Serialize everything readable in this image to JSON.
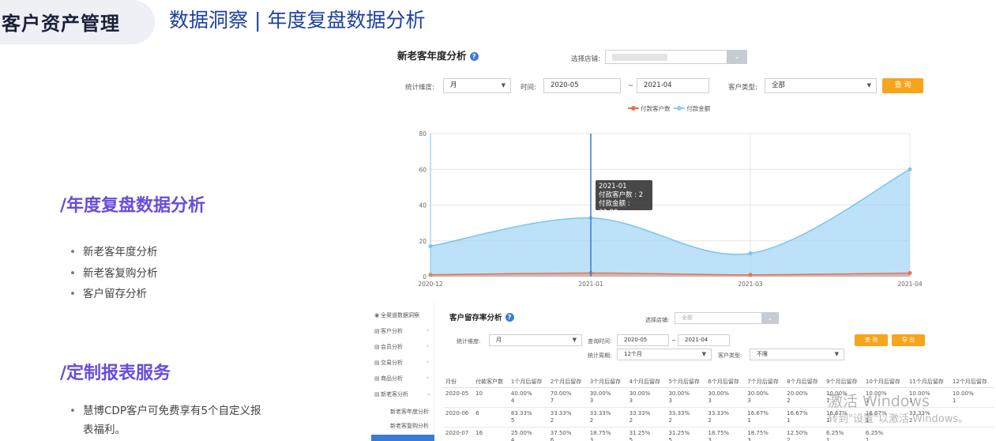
{
  "header": {
    "tab_title": "客户资产管理",
    "subtitle": "数据洞察 |  年度复盘数据分析"
  },
  "left": {
    "section1": {
      "title": "/年度复盘数据分析",
      "items": [
        "新老客年度分析",
        "新老客复购分析",
        "客户留存分析"
      ]
    },
    "section2": {
      "title": "/定制报表服务",
      "items": [
        "慧博CDP客户可免费享有5个自定义报表福利。"
      ]
    }
  },
  "panel1": {
    "title": "新老客年度分析",
    "help_icon": "?",
    "store_label": "选择店铺:",
    "dimension_label": "统计维度:",
    "dimension_value": "月",
    "time_label": "时间:",
    "time_from": "2020-05",
    "time_sep": "~",
    "time_to": "2021-04",
    "customer_type_label": "客户类型:",
    "customer_type_value": "全部",
    "query_label": "查 询",
    "legend": [
      "付款客户数",
      "付款金额"
    ]
  },
  "chart_data": {
    "type": "area",
    "x": [
      "2020-12",
      "2021-01",
      "2021-03",
      "2021-04"
    ],
    "ylim": [
      0,
      80
    ],
    "yticks": [
      0,
      20,
      40,
      60,
      80
    ],
    "grid": true,
    "legend_position": "top-center",
    "series": [
      {
        "name": "付款客户数",
        "values": [
          1,
          2,
          1,
          2
        ],
        "color": "#e8734a"
      },
      {
        "name": "付款金额",
        "values": [
          17,
          32.8,
          13,
          60
        ],
        "color": "#8fcdf4"
      }
    ],
    "tooltip": {
      "x": "2021-01",
      "lines": [
        "2021-01",
        "付款客户数 : 2",
        "付款金额 : 32.80"
      ]
    }
  },
  "panel2": {
    "title": "客户留存率分析",
    "help_icon": "?",
    "store_label": "选择店铺:",
    "store_value": "全部",
    "dimension_label": "统计维度:",
    "dimension_value": "月",
    "query_time_label": "查询时间:",
    "time_from": "2020-05",
    "time_sep": "~",
    "time_to": "2021-04",
    "period_label": "统计周期:",
    "period_value": "12个月",
    "customer_type_label": "客户类型:",
    "customer_type_value": "不限",
    "query_label": "查 询",
    "export_label": "导 出",
    "sidebar": [
      {
        "icon": "◉",
        "label": "全渠道数据洞察",
        "chev": ""
      },
      {
        "icon": "▤",
        "label": "客户分析",
        "chev": "‹"
      },
      {
        "icon": "▤",
        "label": "会员分析",
        "chev": "‹"
      },
      {
        "icon": "▤",
        "label": "交易分析",
        "chev": "‹"
      },
      {
        "icon": "▤",
        "label": "商品分析",
        "chev": "‹"
      },
      {
        "icon": "▤",
        "label": "新老客分析",
        "chev": "⌄"
      },
      {
        "icon": "",
        "label": "新老客年度分析",
        "chev": ""
      },
      {
        "icon": "",
        "label": "新老客复购分析",
        "chev": ""
      }
    ],
    "columns": [
      "月份",
      "付款客户数",
      "1个月后留存",
      "2个月后留存",
      "3个月后留存",
      "4个月后留存",
      "5个月后留存",
      "6个月后留存",
      "7个月后留存",
      "8个月后留存",
      "9个月后留存",
      "10个月后留存",
      "11个月后留存",
      "12个月后留存"
    ],
    "rows": [
      [
        "2020-05",
        "10",
        [
          "40.00%",
          "4"
        ],
        [
          "70.00%",
          "7"
        ],
        [
          "30.00%",
          "3"
        ],
        [
          "30.00%",
          "3"
        ],
        [
          "30.00%",
          "3"
        ],
        [
          "30.00%",
          "3"
        ],
        [
          "30.00%",
          "3"
        ],
        [
          "20.00%",
          "2"
        ],
        [
          "10.00%",
          "1"
        ],
        [
          "10.00%",
          "1"
        ],
        [
          "10.00%",
          "1"
        ],
        [
          "10.00%",
          "1"
        ]
      ],
      [
        "2020-06",
        "6",
        [
          "83.33%",
          "5"
        ],
        [
          "33.33%",
          "2"
        ],
        [
          "33.33%",
          "2"
        ],
        [
          "33.33%",
          "2"
        ],
        [
          "33.33%",
          "2"
        ],
        [
          "33.33%",
          "2"
        ],
        [
          "16.67%",
          "1"
        ],
        [
          "16.67%",
          "1"
        ],
        [
          "16.67%",
          "1"
        ],
        [
          "16.67%",
          "1"
        ],
        [
          "33.33%",
          "2"
        ],
        [
          "",
          ""
        ]
      ],
      [
        "2020-07",
        "16",
        [
          "25.00%",
          "4"
        ],
        [
          "37.50%",
          "6"
        ],
        [
          "18.75%",
          "3"
        ],
        [
          "31.25%",
          "5"
        ],
        [
          "31.25%",
          "5"
        ],
        [
          "18.75%",
          "3"
        ],
        [
          "18.75%",
          "3"
        ],
        [
          "12.50%",
          "2"
        ],
        [
          "6.25%",
          "1"
        ],
        [
          "6.25%",
          "1"
        ],
        [
          "",
          ""
        ],
        [
          "",
          ""
        ]
      ]
    ]
  },
  "watermark": {
    "line1": "激活 Windows",
    "line2": "转到\"设置\"以激活 Windows。"
  }
}
